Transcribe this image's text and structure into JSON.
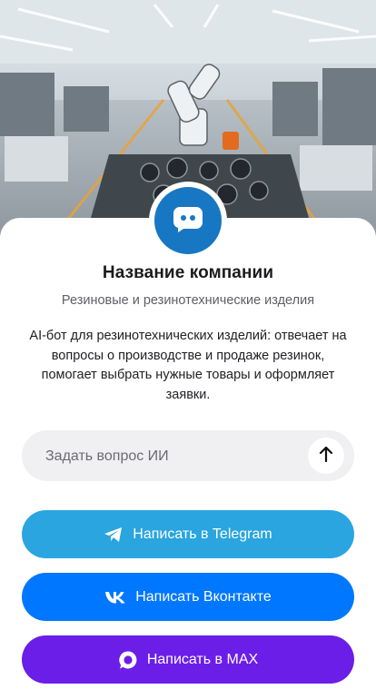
{
  "company": {
    "name": "Название компании",
    "subtitle": "Резиновые и резинотехнические изделия",
    "description": "AI-бот для резинотехнических изделий: отвечает на вопросы о производстве и продаже резинок, помогает выбрать нужные товары и оформляет заявки.",
    "avatar_icon": "chat-bubble-icon"
  },
  "search": {
    "placeholder": "Задать вопрос ИИ",
    "value": "",
    "send_icon": "arrow-up-icon"
  },
  "buttons": {
    "telegram": {
      "label": "Написать в Telegram",
      "icon": "telegram-icon",
      "color": "#2aa5e0"
    },
    "vk": {
      "label": "Написать Вконтакте",
      "icon": "vk-icon",
      "color": "#0077ff"
    },
    "max": {
      "label": "Написать в MAX",
      "icon": "max-icon",
      "color": "#6b1ee8"
    }
  },
  "colors": {
    "accent": "#1877c3",
    "background": "#ffffff",
    "input_bg": "#f0f0f2"
  }
}
